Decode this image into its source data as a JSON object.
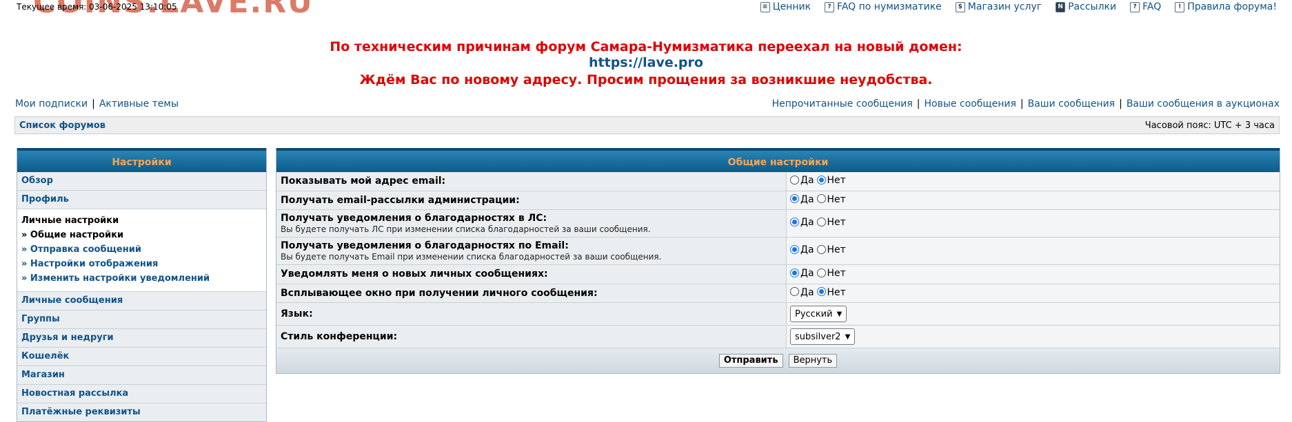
{
  "logo_text": "COINS.LAVE.RU",
  "clock": "Текущее время: 03-06-2025 13:10:05",
  "topnav": [
    {
      "icon": "price-list-icon",
      "glyph": "≡",
      "label": "Ценник"
    },
    {
      "icon": "faq-icon",
      "glyph": "?",
      "label": "FAQ по нумизматике"
    },
    {
      "icon": "coins-icon",
      "glyph": "$",
      "label": "Магазин услуг"
    },
    {
      "icon": "newsletter-icon",
      "glyph": "N",
      "label": "Рассылки"
    },
    {
      "icon": "faq-icon",
      "glyph": "?",
      "label": "FAQ"
    },
    {
      "icon": "rules-icon",
      "glyph": "!",
      "label": "Правила форума!"
    }
  ],
  "announcement": {
    "line1": "По техническим причинам форум Самара-Нумизматика переехал на новый домен:",
    "line2": "https://lave.pro",
    "line3": "Ждём Вас по новому адресу. Просим прощения за возникшие неудобства.",
    "color_alert": "#e00000",
    "color_link": "#105289"
  },
  "links_left": [
    "Мои подписки",
    "Активные темы"
  ],
  "links_right": [
    "Непрочитанные сообщения",
    "Новые сообщения",
    "Ваши сообщения",
    "Ваши сообщения в аукционах"
  ],
  "breadcrumb": {
    "label": "Список форумов",
    "timezone": "Часовой пояс: UTC + 3 часа"
  },
  "sidebar": {
    "title": "Настройки",
    "top_items": [
      "Обзор",
      "Профиль"
    ],
    "group": {
      "title": "Личные настройки",
      "items": [
        {
          "label": "» Общие настройки",
          "active": true
        },
        {
          "label": "» Отправка сообщений",
          "active": false
        },
        {
          "label": "» Настройки отображения",
          "active": false
        },
        {
          "label": "» Изменить настройки уведомлений",
          "active": false
        }
      ]
    },
    "bottom_items": [
      "Личные сообщения",
      "Группы",
      "Друзья и недруги",
      "Кошелёк",
      "Магазин",
      "Новостная рассылка",
      "Платёжные реквизиты"
    ]
  },
  "main": {
    "title": "Общие настройки",
    "yes": "Да",
    "no": "Нет",
    "rows": [
      {
        "label": "Показывать мой адрес email:",
        "hint": "",
        "value": "no"
      },
      {
        "label": "Получать email-рассылки администрации:",
        "hint": "",
        "value": "yes"
      },
      {
        "label": "Получать уведомления о благодарностях в ЛС:",
        "hint": "Вы будете получать ЛС при изменении списка благодарностей за ваши сообщения.",
        "value": "yes"
      },
      {
        "label": "Получать уведомления о благодарностях по Email:",
        "hint": "Вы будете получать Email при изменении списка благодарностей за ваши сообщения.",
        "value": "yes"
      },
      {
        "label": "Уведомлять меня о новых личных сообщениях:",
        "hint": "",
        "value": "yes"
      },
      {
        "label": "Всплывающее окно при получении личного сообщения:",
        "hint": "",
        "value": "no"
      }
    ],
    "language": {
      "label": "Язык:",
      "selected": "Русский"
    },
    "style": {
      "label": "Стиль конференции:",
      "selected": "subsilver2"
    },
    "submit": "Отправить",
    "reset": "Вернуть"
  }
}
